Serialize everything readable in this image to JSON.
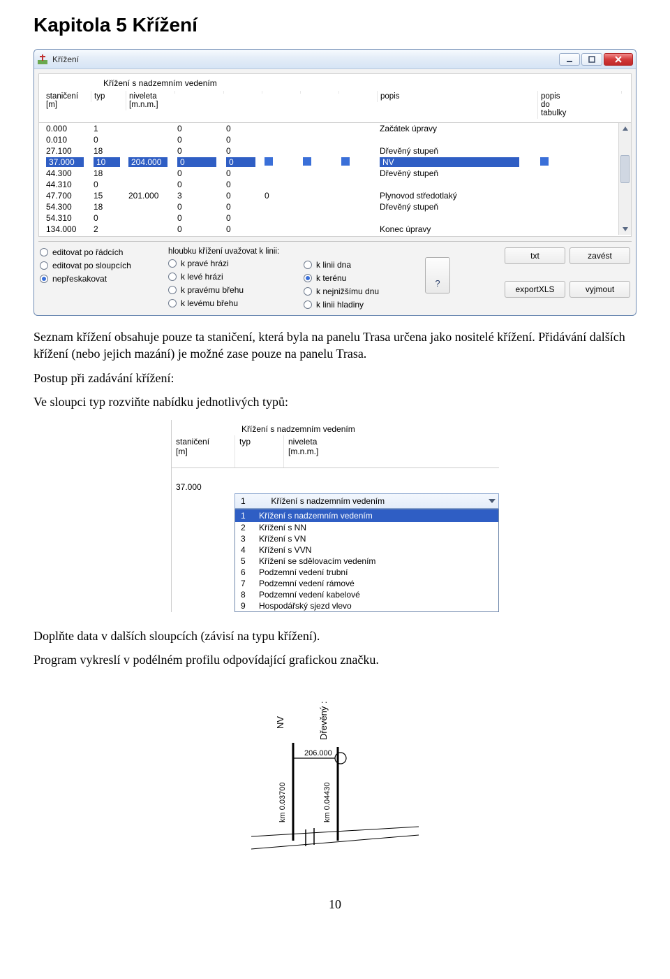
{
  "heading": "Kapitola 5  Křížení",
  "para1": "Seznam křížení obsahuje pouze ta staničení, která byla na panelu Trasa určena jako nositelé křížení. Přidávání dalších křížení (nebo jejich mazání) je možné zase pouze na panelu Trasa.",
  "para2": "Postup při zadávání křížení:",
  "para3": "Ve sloupci typ rozviňte nabídku jednotlivých typů:",
  "para4": "Doplňte data v dalších sloupcích (závisí na typu křížení).",
  "para5": "Program vykreslí v podélném profilu odpovídající grafickou značku.",
  "page_number": "10",
  "window": {
    "title": "Křížení",
    "tab_title": "Křížení s nadzemním vedením",
    "columns": {
      "c1": "staničení\n[m]",
      "c2": "typ",
      "c3": "niveleta\n[m.n.m.]",
      "c4": "",
      "c5": "",
      "c6": "",
      "c7": "",
      "c8": "",
      "c9": "popis",
      "c10": "popis\ndo\ntabulky"
    },
    "rows": [
      {
        "c1": "0.000",
        "c2": "1",
        "c3": "",
        "c4": "0",
        "c5": "0",
        "c6": "",
        "c7": "",
        "c8": "",
        "c9": "Začátek úpravy",
        "c10": ""
      },
      {
        "c1": "0.010",
        "c2": "0",
        "c3": "",
        "c4": "0",
        "c5": "0",
        "c6": "",
        "c7": "",
        "c8": "",
        "c9": "",
        "c10": ""
      },
      {
        "c1": "27.100",
        "c2": "18",
        "c3": "",
        "c4": "0",
        "c5": "0",
        "c6": "",
        "c7": "",
        "c8": "",
        "c9": "Dřevěný stupeň",
        "c10": ""
      },
      {
        "c1": "37.000",
        "c2": "10",
        "c3": "204.000",
        "c4": "0",
        "c5": "0",
        "c6": "",
        "c7": "",
        "c8": "",
        "c9": "NV",
        "c10": "",
        "selected": true
      },
      {
        "c1": "44.300",
        "c2": "18",
        "c3": "",
        "c4": "0",
        "c5": "0",
        "c6": "",
        "c7": "",
        "c8": "",
        "c9": "Dřevěný stupeň",
        "c10": ""
      },
      {
        "c1": "44.310",
        "c2": "0",
        "c3": "",
        "c4": "0",
        "c5": "0",
        "c6": "",
        "c7": "",
        "c8": "",
        "c9": "",
        "c10": ""
      },
      {
        "c1": "47.700",
        "c2": "15",
        "c3": "201.000",
        "c4": "3",
        "c5": "0",
        "c6": "0",
        "c7": "",
        "c8": "",
        "c9": "Plynovod středotlaký",
        "c10": ""
      },
      {
        "c1": "54.300",
        "c2": "18",
        "c3": "",
        "c4": "0",
        "c5": "0",
        "c6": "",
        "c7": "",
        "c8": "",
        "c9": "Dřevěný stupeň",
        "c10": ""
      },
      {
        "c1": "54.310",
        "c2": "0",
        "c3": "",
        "c4": "0",
        "c5": "0",
        "c6": "",
        "c7": "",
        "c8": "",
        "c9": "",
        "c10": ""
      },
      {
        "c1": "134.000",
        "c2": "2",
        "c3": "",
        "c4": "0",
        "c5": "0",
        "c6": "",
        "c7": "",
        "c8": "",
        "c9": "Konec úpravy",
        "c10": ""
      }
    ],
    "radios_left": [
      {
        "label": "editovat po řádcích",
        "selected": false
      },
      {
        "label": "editovat po sloupcích",
        "selected": false
      },
      {
        "label": "nepřeskakovat",
        "selected": true
      }
    ],
    "radios_mid_head": "hloubku křížení uvažovat k linii:",
    "radios_mid": [
      {
        "label": "k pravé hrázi",
        "selected": false
      },
      {
        "label": "k levé hrázi",
        "selected": false
      },
      {
        "label": "k pravému břehu",
        "selected": false
      },
      {
        "label": "k levému břehu",
        "selected": false
      }
    ],
    "radios_right": [
      {
        "label": "k linii dna",
        "selected": false
      },
      {
        "label": "k terénu",
        "selected": true
      },
      {
        "label": "k nejnižšímu dnu",
        "selected": false
      },
      {
        "label": "k linii hladiny",
        "selected": false
      }
    ],
    "help_btn": "?",
    "buttons": {
      "txt": "txt",
      "zavest": "zavést",
      "exportXLS": "exportXLS",
      "vyjmout": "vyjmout"
    }
  },
  "mini": {
    "tab_title": "Křížení s nadzemním vedením",
    "columns": {
      "c1": "staničení\n[m]",
      "c2": "typ",
      "c3": "niveleta\n[m.n.m.]"
    },
    "row_value": "37.000",
    "combo_text": "1           Křížení s nadzemním vedením",
    "highlight": {
      "n": "1",
      "t": "Křížení s nadzemním vedením"
    },
    "options": [
      {
        "n": "2",
        "t": "Křížení s NN"
      },
      {
        "n": "3",
        "t": "Křížení s VN"
      },
      {
        "n": "4",
        "t": "Křížení s VVN"
      },
      {
        "n": "5",
        "t": "Křížení se sdělovacím vedením"
      },
      {
        "n": "6",
        "t": "Podzemní vedení trubní"
      },
      {
        "n": "7",
        "t": "Podzemní vedení rámové"
      },
      {
        "n": "8",
        "t": "Podzemní vedení kabelové"
      },
      {
        "n": "9",
        "t": "Hospodářský sjezd vlevo"
      }
    ]
  },
  "diagram": {
    "label_nv": "NV",
    "label_drev": "Dřevěný :",
    "elev": "206.000",
    "km1": "km 0.03700",
    "km2": "km 0.04430"
  }
}
